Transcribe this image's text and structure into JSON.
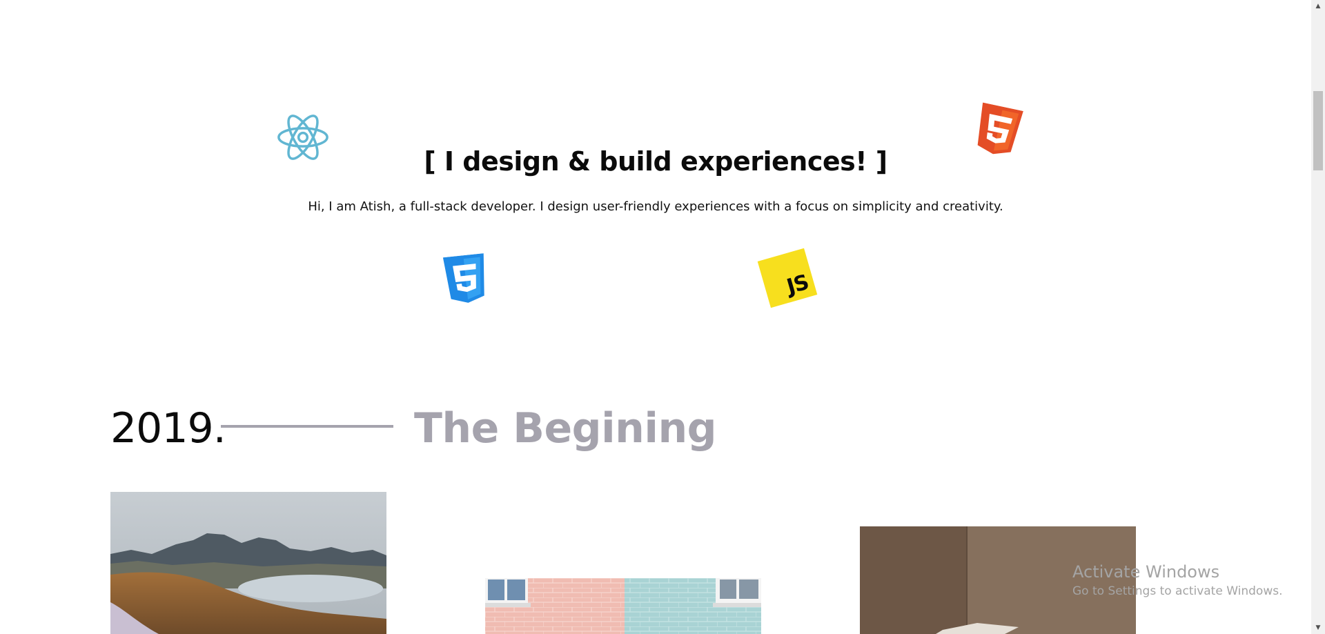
{
  "hero": {
    "title": "[ I design & build experiences! ]",
    "description": "Hi, I am Atish, a full-stack developer. I design user-friendly experiences with a focus on simplicity and creativity."
  },
  "tech_icons": {
    "react": "react-icon",
    "html5": "html5-icon",
    "css3": "css3-icon",
    "js": {
      "name": "javascript-icon",
      "label": "JS"
    }
  },
  "timeline": {
    "year": "2019.",
    "title": "The Begining"
  },
  "gallery": {
    "photos": [
      "photo-mountain-lake",
      "photo-brick-wall",
      "photo-interior"
    ]
  },
  "watermark": {
    "title": "Activate Windows",
    "subtitle": "Go to Settings to activate Windows."
  },
  "colors": {
    "text": "#0b0b0b",
    "muted": "#a5a3ad",
    "react": "#61b6d2",
    "html5": "#f06529",
    "css3": "#2196f3",
    "js": "#f7df1e"
  }
}
